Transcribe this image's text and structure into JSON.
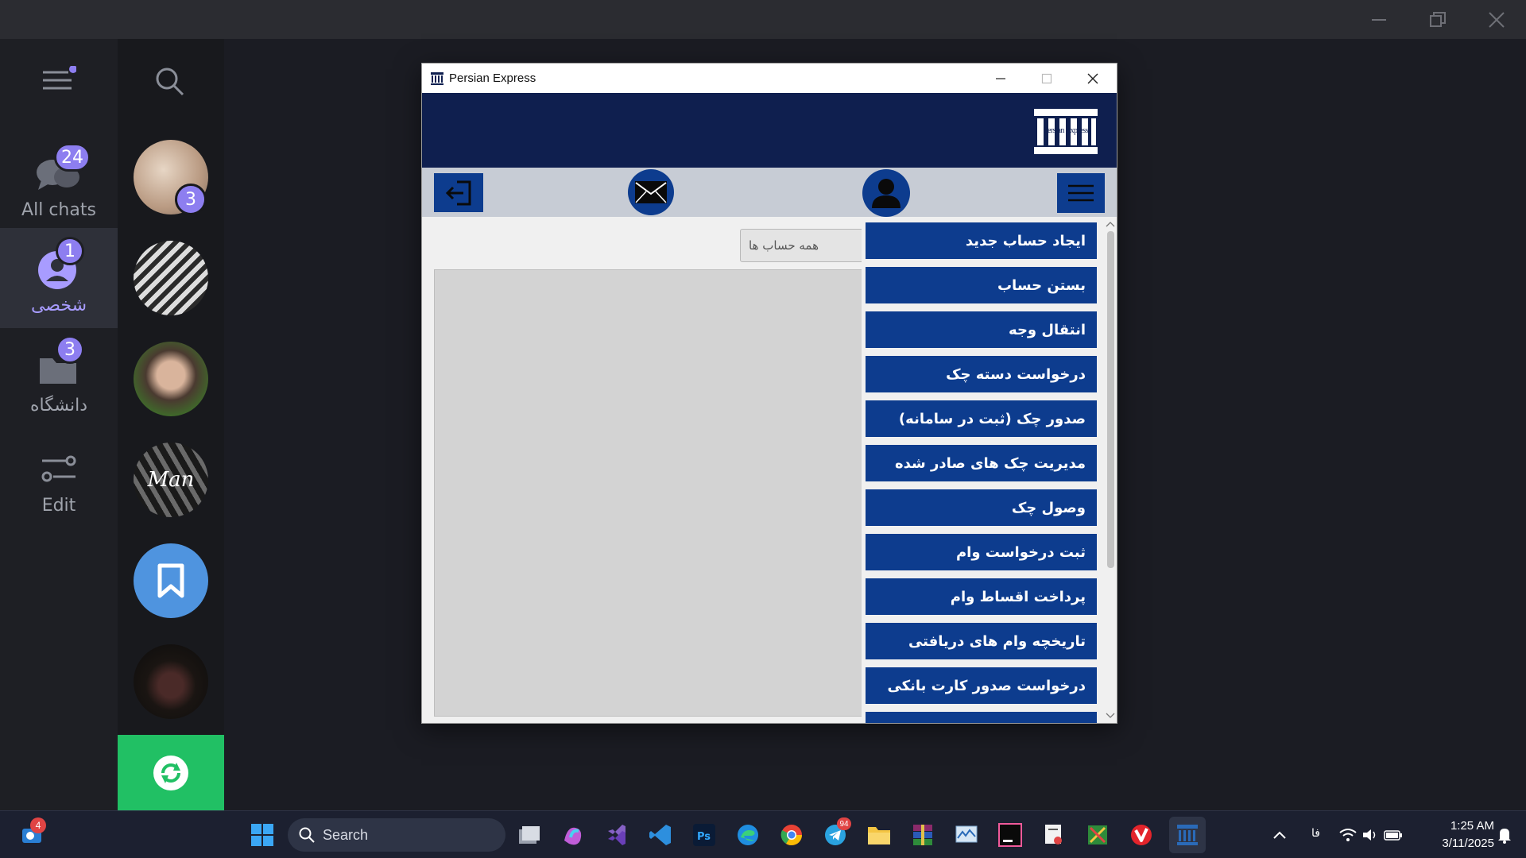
{
  "telegram": {
    "folders": [
      {
        "label": "All chats",
        "badge": "24",
        "icon": "chats-icon"
      },
      {
        "label": "شخصی",
        "badge": "1",
        "icon": "person-icon"
      },
      {
        "label": "دانشگاه",
        "badge": "3",
        "icon": "folder-icon"
      },
      {
        "label": "Edit",
        "badge": "",
        "icon": "sliders-icon"
      }
    ],
    "avatars": [
      {
        "badge": "3"
      },
      {
        "badge": ""
      },
      {
        "badge": ""
      },
      {
        "badge": "",
        "signature": "Man"
      },
      {
        "badge": "",
        "icon": "bookmark-icon"
      },
      {
        "badge": ""
      }
    ]
  },
  "app": {
    "window_title": "Persian Express",
    "logo_text": "Persian Express",
    "account_filter": "همه حساب ها",
    "menu_items": [
      "ایجاد حساب جدید",
      "بستن حساب",
      "انتقال وجه",
      "درخواست دسته چک",
      "صدور چک (ثبت در سامانه)",
      "مدیریت چک های صادر شده",
      "وصول چک",
      "ثبت درخواست وام",
      "پرداخت اقساط وام",
      "تاریخچه وام های دریافتی",
      "درخواست صدور کارت بانکی"
    ],
    "colors": {
      "header": "#0f1f4f",
      "menu_button": "#0d3c8e",
      "toolbar": "#c7ccd5"
    }
  },
  "taskbar": {
    "search_placeholder": "Search",
    "outlook_badge": "4",
    "telegram_badge": "94",
    "language": "فا",
    "time": "1:25 AM",
    "date": "3/11/2025"
  }
}
